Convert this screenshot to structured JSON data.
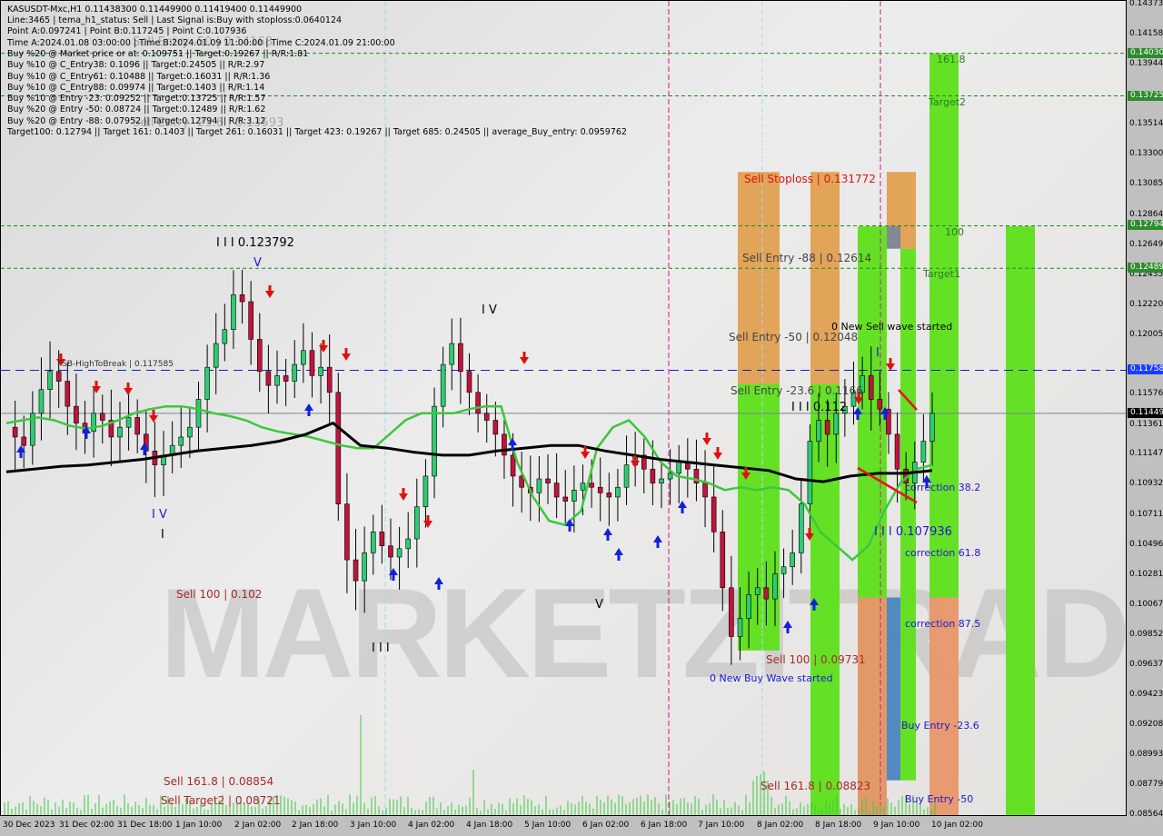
{
  "header": {
    "symbol_line": "KASUSDT-Mxc,H1  0.11438300 0.11449900 0.11419400 0.11449900",
    "lines": [
      "Line:3465 | tema_h1_status: Sell | Last Signal is:Buy with stoploss:0.0640124",
      "Point A:0.097241 | Point B:0.117245 | Point C:0.107936",
      "Time A:2024.01.08 03:00:00 | Time B:2024.01.09 11:00:00 | Time C:2024.01.09 21:00:00",
      "Buy %20 @ Market price or at: 0.109751 || Target:0.19267 || R/R:1.81",
      "Buy %10 @ C_Entry38: 0.1096 || Target:0.24505 || R/R:2.97",
      "Buy %10 @ C_Entry61: 0.10488 || Target:0.16031 || R/R:1.36",
      "Buy %10 @ C_Entry88: 0.09974 || Target:0.1403 || R/R:1.14",
      "Buy %10 @ Entry -23: 0.09252 || Target:0.13725 || R/R:1.57",
      "Buy %20 @ Entry -50: 0.08724 || Target:0.12489 || R/R:1.62",
      "Buy %20 @ Entry -88: 0.07952 || Target:0.12794 || R/R:3.12",
      "Target100: 0.12794 || Target 161: 0.1403 || Target 261: 0.16031 || Target 423: 0.19267 || Target 685: 0.24505 || average_Buy_entry: 0.0959762"
    ],
    "ghost_labels": [
      "Sell Entry -50 | 0.14168",
      "Sell Entry -23.6 | 0.13593"
    ]
  },
  "watermark": "MARKETZITRADE",
  "colors": {
    "bull": "#2ecc71",
    "bear": "#c0143c",
    "ema_green": "#3cc83c",
    "ema_black": "#000000",
    "target_line": "#1a8a1a",
    "fsb_line": "#1a1acc",
    "green_zone": "#5ee01a",
    "orange_zone": "#e0a050",
    "salmon_zone": "#e8966a",
    "grey_zone": "#7a8898",
    "blue_zone": "#4a86c0",
    "badge_green": "#2e8b2e",
    "badge_blue": "#1a3cff",
    "badge_black": "#000000"
  },
  "chart_data": {
    "type": "candlestick",
    "title": "KASUSDT-Mxc,H1",
    "ylim": [
      0.08564,
      0.14373
    ],
    "y_ticks": [
      "0.14373",
      "0.14158",
      "0.13944",
      "0.13514",
      "0.13300",
      "0.13085",
      "0.12864",
      "0.12649",
      "0.12435",
      "0.12220",
      "0.12005",
      "0.11576",
      "0.11361",
      "0.11147",
      "0.10932",
      "0.10711",
      "0.10496",
      "0.10281",
      "0.10067",
      "0.09852",
      "0.09637",
      "0.09423",
      "0.09208",
      "0.08993",
      "0.08779",
      "0.08564"
    ],
    "price_badges": [
      {
        "value": "0.14030",
        "price": 0.1403,
        "color": "green"
      },
      {
        "value": "0.13725",
        "price": 0.13725,
        "color": "green"
      },
      {
        "value": "0.12794",
        "price": 0.12794,
        "color": "green"
      },
      {
        "value": "0.12489",
        "price": 0.12489,
        "color": "green"
      },
      {
        "value": "0.11758",
        "price": 0.117585,
        "color": "blue"
      },
      {
        "value": "0.11449",
        "price": 0.114499,
        "color": "black"
      }
    ],
    "x_ticks": [
      "30 Dec 2023",
      "31 Dec 02:00",
      "31 Dec 18:00",
      "1 Jan 10:00",
      "2 Jan 02:00",
      "2 Jan 18:00",
      "3 Jan 10:00",
      "4 Jan 02:00",
      "4 Jan 18:00",
      "5 Jan 10:00",
      "6 Jan 02:00",
      "6 Jan 18:00",
      "7 Jan 10:00",
      "8 Jan 02:00",
      "8 Jan 18:00",
      "9 Jan 10:00",
      "10 Jan 02:00"
    ],
    "horizontal_levels": [
      {
        "name": "target-161.8",
        "price": 0.1403,
        "style": "dashed-green"
      },
      {
        "name": "target2",
        "price": 0.13725,
        "style": "dashed-green"
      },
      {
        "name": "target-100",
        "price": 0.12794,
        "style": "dashed-green"
      },
      {
        "name": "target1",
        "price": 0.12489,
        "style": "dashed-green"
      },
      {
        "name": "fsb-high-to-break",
        "price": 0.117585,
        "style": "dashed-blue"
      },
      {
        "name": "current-price",
        "price": 0.114499,
        "style": "solid-grey"
      }
    ],
    "close_series": [
      0.1135,
      0.1128,
      0.1122,
      0.1145,
      0.1162,
      0.1175,
      0.1168,
      0.115,
      0.1138,
      0.1132,
      0.1145,
      0.114,
      0.1128,
      0.1135,
      0.1142,
      0.113,
      0.1118,
      0.1108,
      0.1115,
      0.1122,
      0.1128,
      0.1135,
      0.1155,
      0.1178,
      0.1195,
      0.1205,
      0.123,
      0.1225,
      0.1198,
      0.1175,
      0.1165,
      0.1172,
      0.1168,
      0.118,
      0.119,
      0.1172,
      0.1178,
      0.116,
      0.108,
      0.104,
      0.1025,
      0.1045,
      0.106,
      0.105,
      0.1042,
      0.1048,
      0.1055,
      0.1078,
      0.11,
      0.115,
      0.118,
      0.1195,
      0.1175,
      0.116,
      0.1145,
      0.114,
      0.113,
      0.1115,
      0.11,
      0.1092,
      0.1088,
      0.1098,
      0.1095,
      0.1085,
      0.1082,
      0.109,
      0.1095,
      0.1092,
      0.1088,
      0.1085,
      0.1092,
      0.1108,
      0.1115,
      0.1105,
      0.1095,
      0.1098,
      0.1102,
      0.111,
      0.1105,
      0.1095,
      0.1085,
      0.106,
      0.102,
      0.0985,
      0.0998,
      0.1015,
      0.102,
      0.1012,
      0.103,
      0.1035,
      0.1045,
      0.108,
      0.1125,
      0.114,
      0.113,
      0.1145,
      0.115,
      0.116,
      0.1172,
      0.1155,
      0.1148,
      0.113,
      0.1105,
      0.1095,
      0.111,
      0.1125,
      0.1145
    ],
    "ema_green": [
      0.1138,
      0.114,
      0.1142,
      0.114,
      0.1136,
      0.1134,
      0.1136,
      0.114,
      0.1145,
      0.1148,
      0.115,
      0.115,
      0.1148,
      0.1145,
      0.1143,
      0.114,
      0.1135,
      0.1132,
      0.113,
      0.1128,
      0.1125,
      0.1122,
      0.112,
      0.112,
      0.113,
      0.114,
      0.1145,
      0.1145,
      0.1145,
      0.1148,
      0.115,
      0.115,
      0.111,
      0.1085,
      0.1068,
      0.1065,
      0.1075,
      0.112,
      0.1135,
      0.114,
      0.1128,
      0.111,
      0.11,
      0.1098,
      0.1095,
      0.109,
      0.1092,
      0.109,
      0.1092,
      0.109,
      0.108,
      0.106,
      0.105,
      0.104,
      0.105,
      0.1075,
      0.1095,
      0.1105,
      0.1108
    ],
    "ema_black": [
      0.1103,
      0.1105,
      0.1107,
      0.1108,
      0.111,
      0.1112,
      0.1115,
      0.1118,
      0.112,
      0.1122,
      0.1125,
      0.113,
      0.1138,
      0.1122,
      0.112,
      0.1117,
      0.1115,
      0.1115,
      0.1118,
      0.112,
      0.1122,
      0.1122,
      0.1118,
      0.1115,
      0.1112,
      0.111,
      0.1108,
      0.1106,
      0.1104,
      0.1098,
      0.1096,
      0.11,
      0.1102,
      0.1102,
      0.1104
    ],
    "volume_bars": "green histogram at bottom, spike near 3 Jan 10:00",
    "annotations": [
      {
        "text": "I I I 0.123792",
        "price": 0.12379,
        "color": "black"
      },
      {
        "text": "V",
        "price": 0.1237,
        "color": "blue"
      },
      {
        "text": "I V",
        "price": 0.1098,
        "color": "blue"
      },
      {
        "text": "I",
        "price": 0.1072,
        "color": "black"
      },
      {
        "text": "I V",
        "price": 0.121,
        "color": "black"
      },
      {
        "text": "V",
        "price": 0.1006,
        "color": "black"
      },
      {
        "text": "I I I",
        "price": 0.0965,
        "color": "black"
      },
      {
        "text": "I I I 0.112",
        "price": 0.1145,
        "color": "black"
      },
      {
        "text": "I",
        "price": 0.1185,
        "color": "blue"
      },
      {
        "text": "I I I 0.107936",
        "price": 0.1077,
        "color": "blue"
      },
      {
        "text": "FSB-HighToBreak | 0.117585",
        "price": 0.1176,
        "color": "dark"
      },
      {
        "text": "Sell 100 | 0.102",
        "price": 0.1018,
        "color": "darkred"
      },
      {
        "text": "Sell 161.8 | 0.08854",
        "price": 0.0885,
        "color": "darkred"
      },
      {
        "text": "Sell Target2 | 0.08721",
        "price": 0.0872,
        "color": "darkred"
      },
      {
        "text": "Sell Stoploss | 0.131772",
        "price": 0.1318,
        "color": "red"
      },
      {
        "text": "Sell Entry -88 | 0.12614",
        "price": 0.1262,
        "color": "dark"
      },
      {
        "text": "Sell Entry -50 | 0.12048",
        "price": 0.1205,
        "color": "dark"
      },
      {
        "text": "Sell Entry -23.6 | 0.1166",
        "price": 0.1166,
        "color": "dark"
      },
      {
        "text": "0 New Sell wave started",
        "price": 0.1215,
        "color": "black"
      },
      {
        "text": "Sell 100 | 0.09731",
        "price": 0.0973,
        "color": "darkred"
      },
      {
        "text": "0 New Buy Wave started",
        "price": 0.0955,
        "color": "blue"
      },
      {
        "text": "Sell 161.8 | 0.08823",
        "price": 0.0882,
        "color": "darkred"
      },
      {
        "text": "correction 38.2",
        "price": 0.1096,
        "color": "blue"
      },
      {
        "text": "correction 61.8",
        "price": 0.1049,
        "color": "blue"
      },
      {
        "text": "correction 87.5",
        "price": 0.0997,
        "color": "blue"
      },
      {
        "text": "Buy Entry -23.6",
        "price": 0.0925,
        "color": "blue"
      },
      {
        "text": "Buy Entry -50",
        "price": 0.0872,
        "color": "blue"
      },
      {
        "text": "161.8",
        "price": 0.14,
        "color": "green"
      },
      {
        "text": "Target2",
        "price": 0.1369,
        "color": "green"
      },
      {
        "text": "100",
        "price": 0.1276,
        "color": "green"
      },
      {
        "text": "Target1",
        "price": 0.1245,
        "color": "green"
      }
    ]
  }
}
